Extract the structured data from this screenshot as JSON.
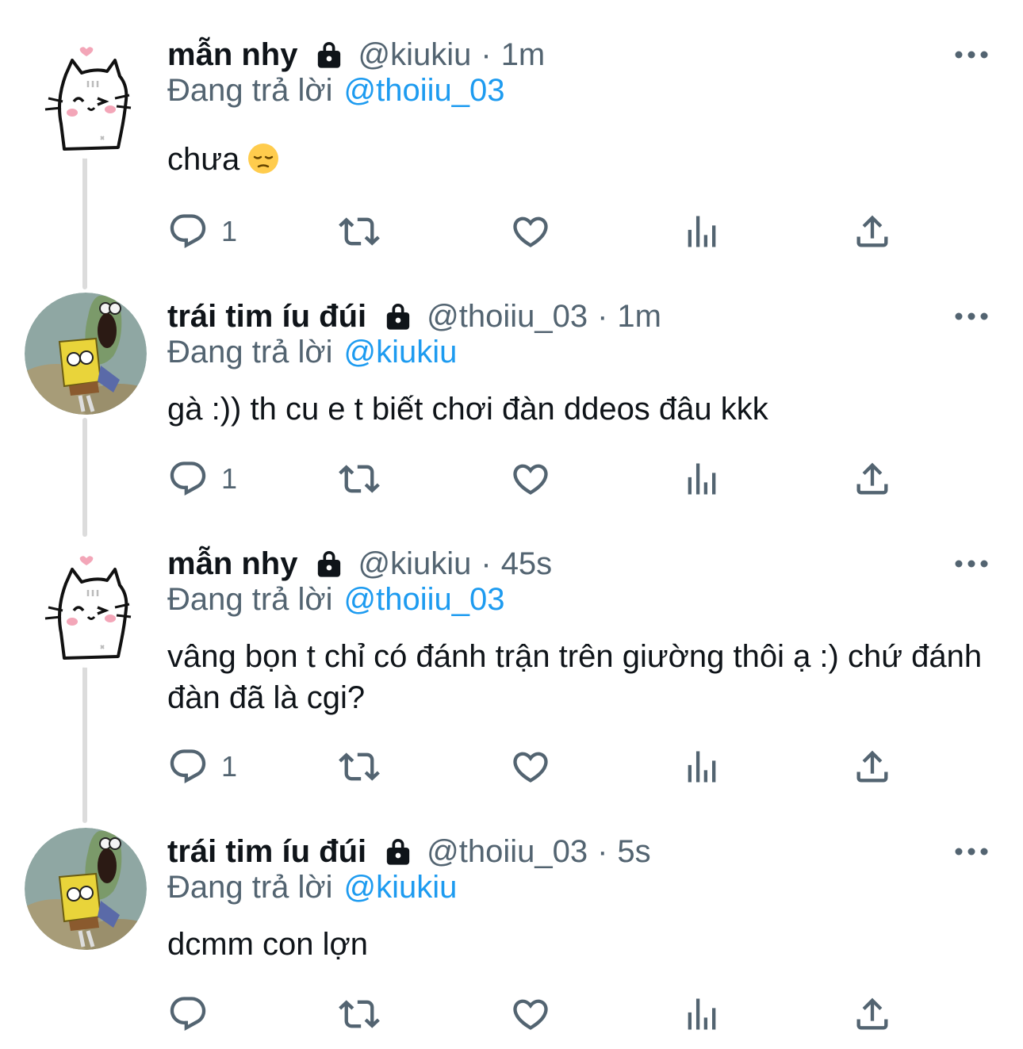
{
  "tweets": [
    {
      "name": "mẫn nhy",
      "handle": "@kiukiu",
      "separator": "·",
      "time": "1m",
      "replying_prefix": "Đang trả lời",
      "replying_to": "@thoiiu_03",
      "text": "chưa",
      "emoji": "pensive-face",
      "reply_count": "1",
      "avatar": "cat-doodle"
    },
    {
      "name": "trái tim íu đúi",
      "handle": "@thoiiu_03",
      "separator": "·",
      "time": "1m",
      "replying_prefix": "Đang trả lời",
      "replying_to": "@kiukiu",
      "text": "gà :)) th cu e t biết chơi đàn ddeos đâu kkk",
      "reply_count": "1",
      "avatar": "spongebob"
    },
    {
      "name": "mẫn nhy",
      "handle": "@kiukiu",
      "separator": "·",
      "time": "45s",
      "replying_prefix": "Đang trả lời",
      "replying_to": "@thoiiu_03",
      "text": "vâng bọn t chỉ có đánh trận trên giường thôi ạ :) chứ đánh đàn đã là cgi?",
      "reply_count": "1",
      "avatar": "cat-doodle"
    },
    {
      "name": "trái tim íu đúi",
      "handle": "@thoiiu_03",
      "separator": "·",
      "time": "5s",
      "replying_prefix": "Đang trả lời",
      "replying_to": "@kiukiu",
      "text": "dcmm con lợn",
      "reply_count": "",
      "avatar": "spongebob"
    }
  ],
  "icons": {
    "reply": "reply-icon",
    "retweet": "retweet-icon",
    "like": "like-icon",
    "views": "views-icon",
    "share": "share-icon",
    "more": "more-icon",
    "lock": "lock-icon"
  },
  "colors": {
    "text": "#0f1419",
    "secondary": "#536471",
    "mention": "#1d9bf0",
    "thread_line": "#dcdcdc"
  }
}
